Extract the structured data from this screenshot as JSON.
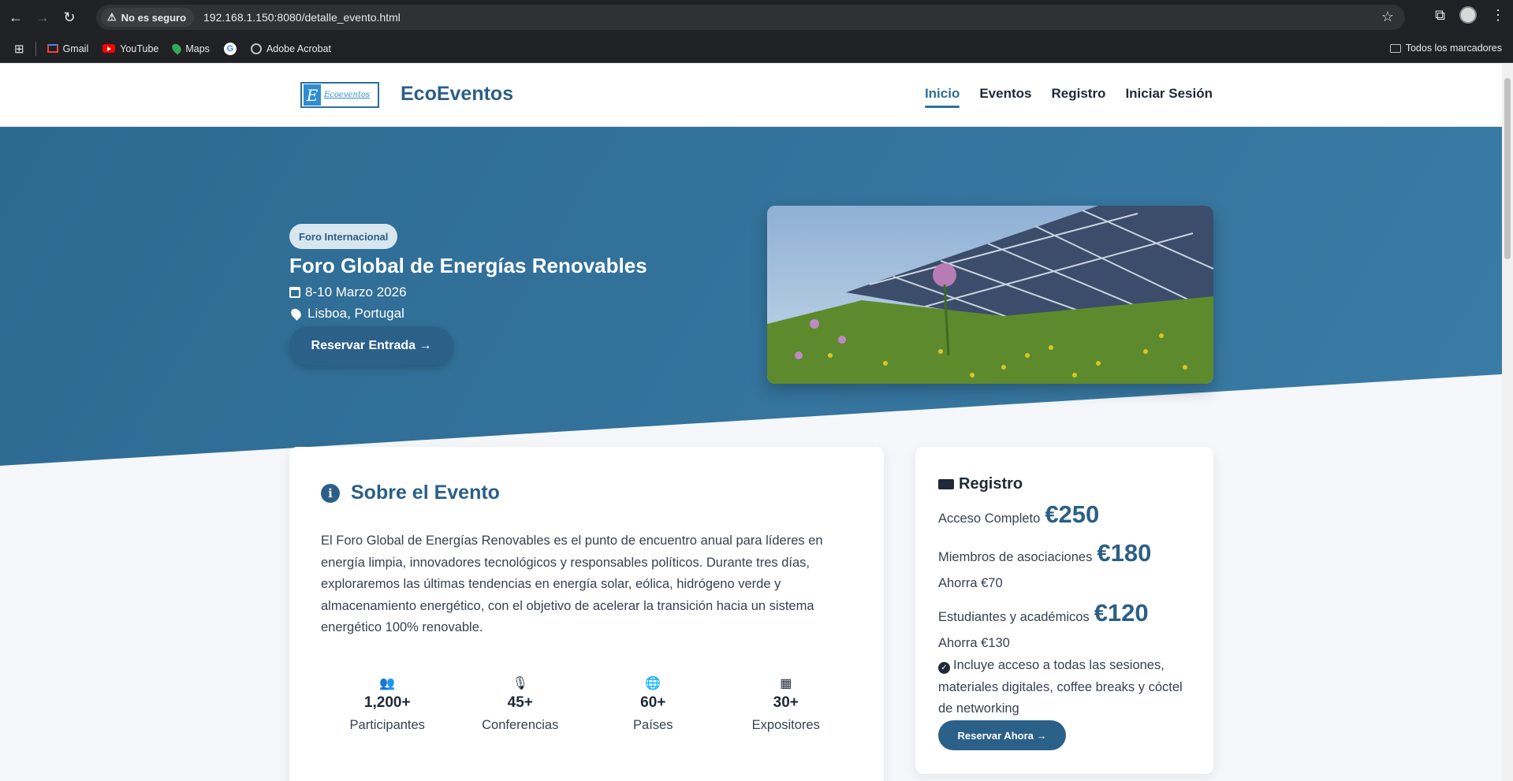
{
  "browser": {
    "security_label": "No es seguro",
    "url": "192.168.1.150:8080/detalle_evento.html",
    "bookmarks": [
      "Gmail",
      "YouTube",
      "Maps",
      "Adobe Acrobat"
    ],
    "all_bookmarks": "Todos los marcadores"
  },
  "site": {
    "logo_text": "Ecoeventos",
    "brand": "EcoEventos",
    "nav": [
      "Inicio",
      "Eventos",
      "Registro",
      "Iniciar Sesión"
    ]
  },
  "hero": {
    "badge": "Foro Internacional",
    "title": "Foro Global de Energías Renovables",
    "date": "8-10 Marzo 2026",
    "location": "Lisboa, Portugal",
    "cta": "Reservar Entrada →"
  },
  "about": {
    "title": "Sobre el Evento",
    "text": "El Foro Global de Energías Renovables es el punto de encuentro anual para líderes en energía limpia, innovadores tecnológicos y responsables políticos. Durante tres días, exploraremos las últimas tendencias en energía solar, eólica, hidrógeno verde y almacenamiento energético, con el objetivo de acelerar la transición hacia un sistema energético 100% renovable.",
    "stats": [
      {
        "icon": "users-icon",
        "value": "1,200+",
        "label": "Participantes"
      },
      {
        "icon": "microphone-icon",
        "value": "45+",
        "label": "Conferencias"
      },
      {
        "icon": "globe-icon",
        "value": "60+",
        "label": "Países"
      },
      {
        "icon": "building-icon",
        "value": "30+",
        "label": "Expositores"
      }
    ]
  },
  "registration": {
    "title": "Registro",
    "tiers": [
      {
        "label": "Acceso Completo",
        "price": "€250",
        "saving": ""
      },
      {
        "label": "Miembros de asociaciones",
        "price": "€180",
        "saving": "Ahorra €70"
      },
      {
        "label": "Estudiantes y académicos",
        "price": "€120",
        "saving": "Ahorra €130"
      }
    ],
    "includes": "Incluye acceso a todas las sesiones, materiales digitales, coffee breaks y cóctel de networking",
    "cta": "Reservar Ahora →"
  },
  "colors": {
    "primary": "#2b5f87",
    "hero": "#3575a0",
    "button": "#2b6089"
  }
}
